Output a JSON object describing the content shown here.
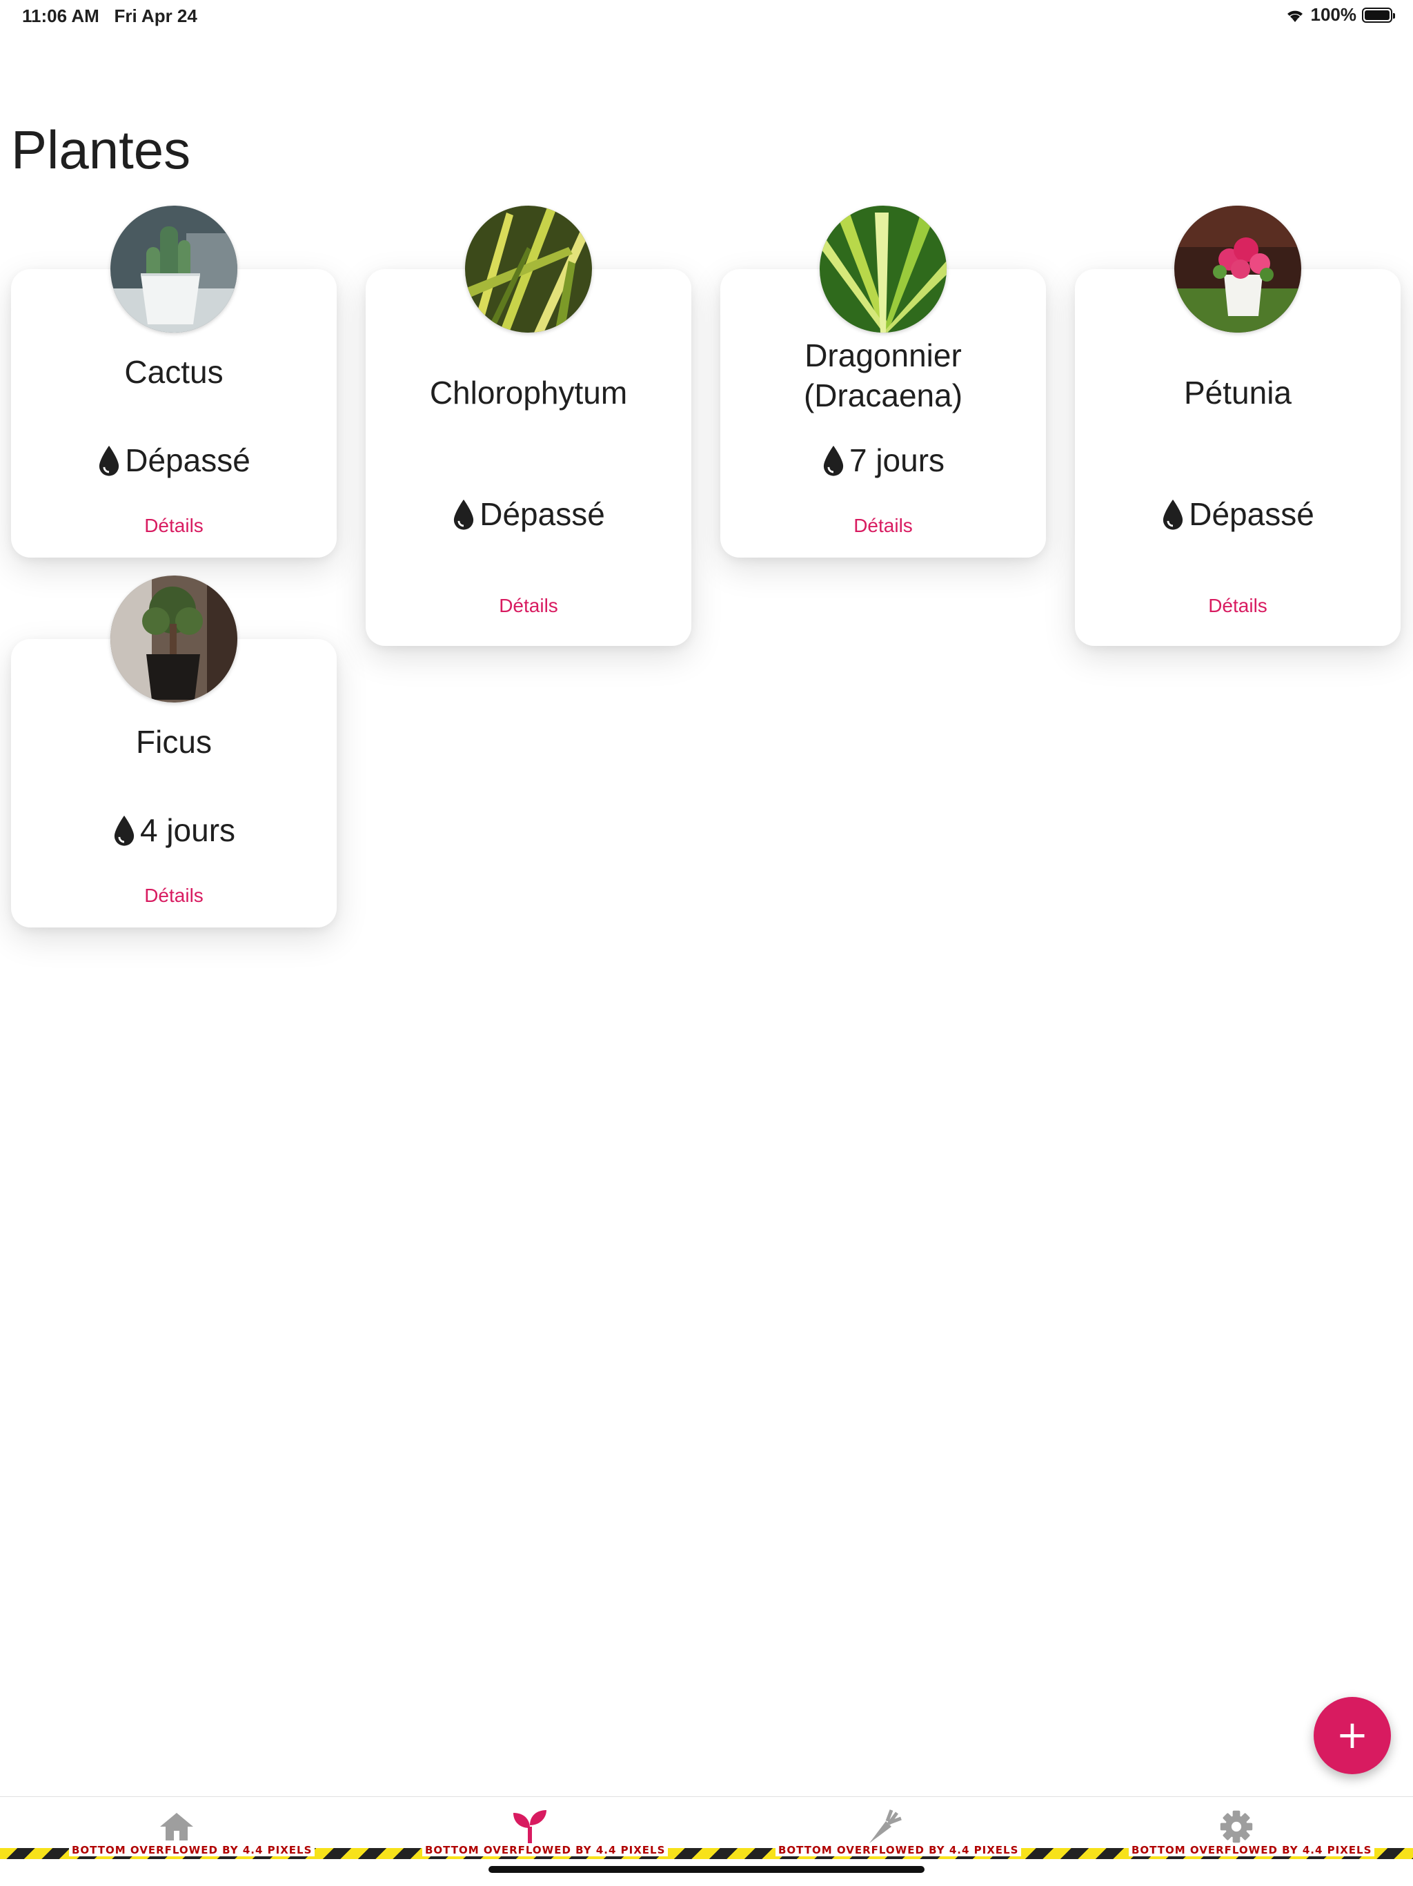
{
  "status_bar": {
    "time": "11:06 AM",
    "date": "Fri Apr 24",
    "battery": "100%"
  },
  "page": {
    "title": "Plantes"
  },
  "plants": [
    {
      "name": "Cactus",
      "water": "Dépassé",
      "details": "Détails",
      "image": "cactus-photo"
    },
    {
      "name": "Chlorophytum",
      "water": "Dépassé",
      "details": "Détails",
      "image": "chlorophytum-photo"
    },
    {
      "name": "Dragonnier",
      "name2": "(Dracaena)",
      "water": "7 jours",
      "details": "Détails",
      "image": "dracaena-photo"
    },
    {
      "name": "Pétunia",
      "water": "Dépassé",
      "details": "Détails",
      "image": "petunia-photo"
    },
    {
      "name": "Ficus",
      "water": "4 jours",
      "details": "Détails",
      "image": "ficus-photo"
    }
  ],
  "fab": {
    "label": "+"
  },
  "bottom_nav": {
    "items": [
      {
        "icon": "home-icon"
      },
      {
        "icon": "sprout-icon",
        "active": true
      },
      {
        "icon": "carrot-icon"
      },
      {
        "icon": "gear-icon"
      }
    ],
    "overflow_text": "BOTTOM OVERFLOWED BY 4.4 PIXELS"
  },
  "colors": {
    "accent": "#d81b60",
    "inactive_icon": "#9e9e9e"
  }
}
